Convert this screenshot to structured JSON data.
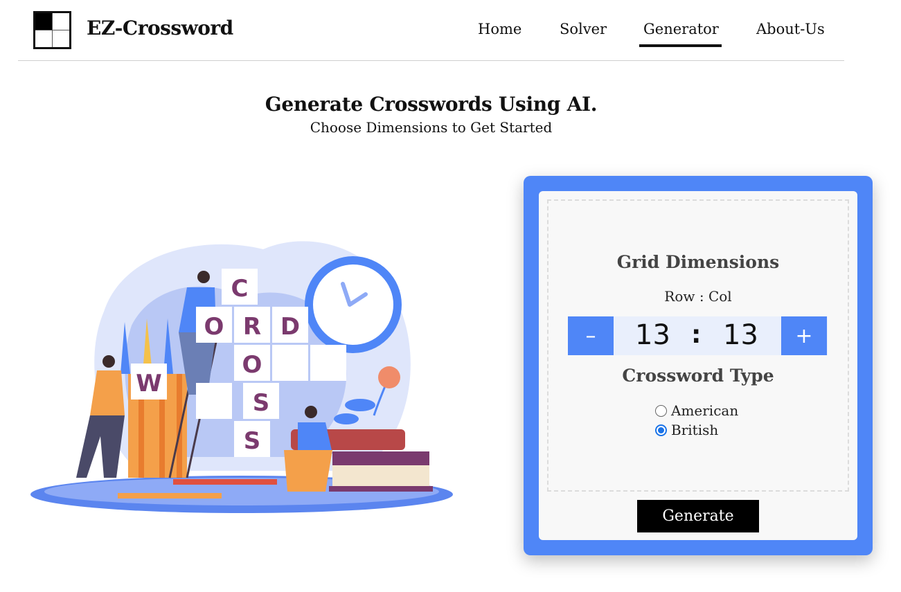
{
  "app": {
    "brand": "EZ-Crossword",
    "icon": "crossword-grid-logo"
  },
  "nav": {
    "items": [
      {
        "label": "Home"
      },
      {
        "label": "Solver"
      },
      {
        "label": "Generator",
        "active": true
      },
      {
        "label": "About-Us"
      }
    ]
  },
  "main": {
    "title": "Generate Crosswords Using AI.",
    "subtitle": "Choose Dimensions to Get Started"
  },
  "illustration": {
    "tiles": [
      "C",
      "O",
      "R",
      "D",
      "W",
      "O",
      "S",
      "S"
    ]
  },
  "form": {
    "grid_title": "Grid Dimensions",
    "rowcol_label": "Row : Col",
    "minus_label": "–",
    "plus_label": "+",
    "rows": "13",
    "separator": ":",
    "cols": "13",
    "type_title": "Crossword Type",
    "types": [
      {
        "label": "American",
        "checked": false
      },
      {
        "label": "British",
        "checked": true
      }
    ],
    "generate_label": "Generate"
  },
  "colors": {
    "accent": "#4f86f7",
    "tile_letter": "#7b3a6e",
    "radio_checked": "#1a73e8"
  }
}
